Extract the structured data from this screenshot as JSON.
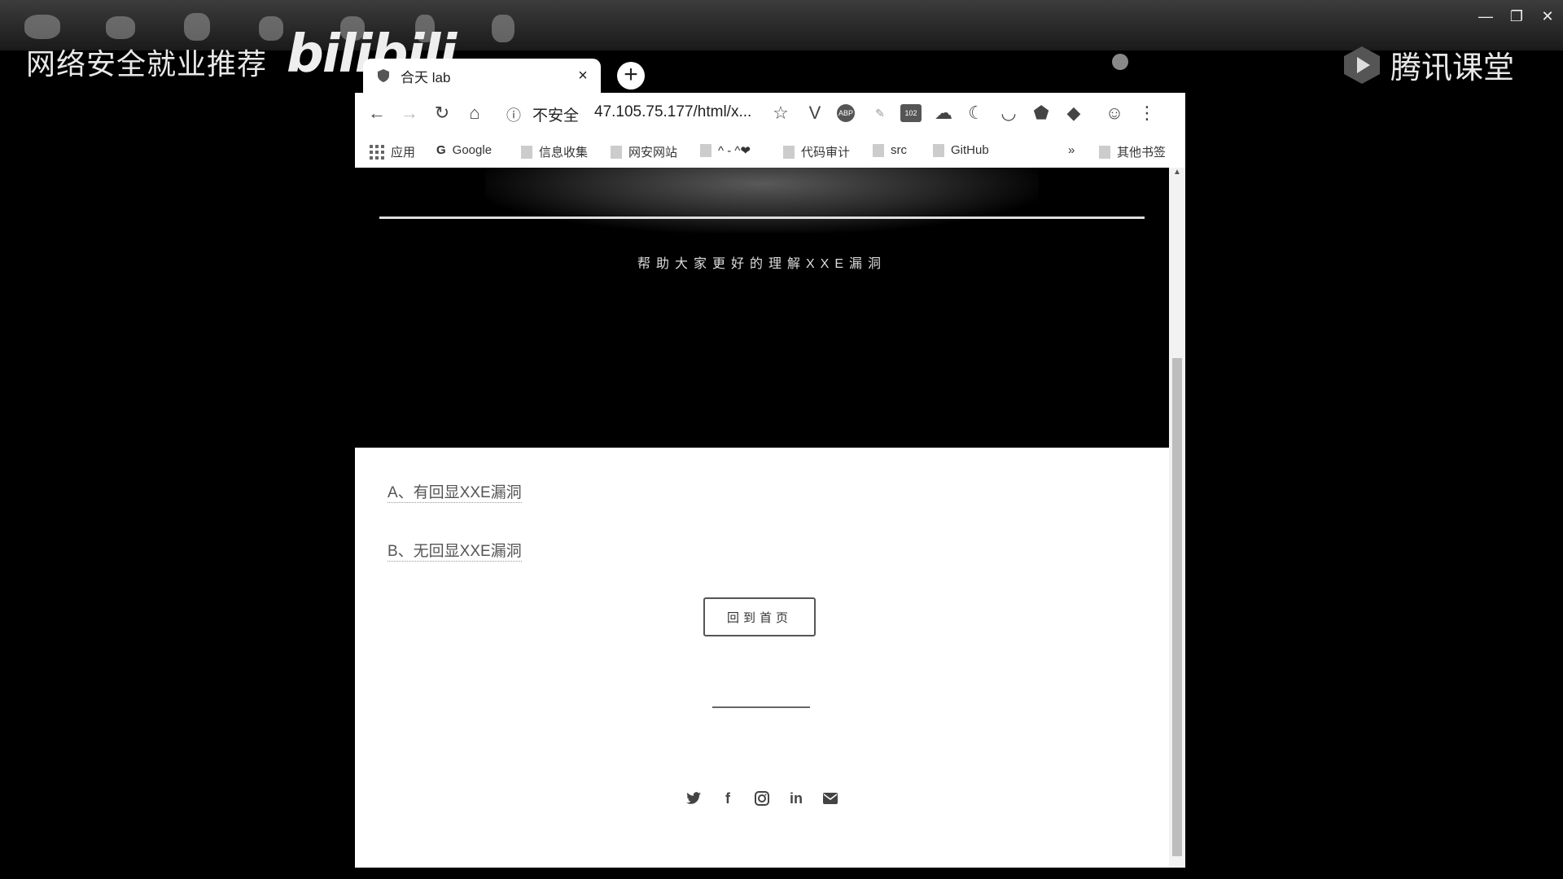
{
  "overlay": {
    "left_title": "网络安全就业推荐",
    "bili_logo": "bilibili",
    "tencent_logo": "腾讯课堂"
  },
  "browser": {
    "tab_title": "合天 lab",
    "tab_close": "×",
    "new_tab": "+",
    "address": {
      "security_label": "不安全",
      "url": "47.105.75.177/html/x..."
    },
    "extensions": [
      "ABP",
      "102"
    ],
    "bookmarks": [
      {
        "label": "应用",
        "icon": "apps-grid-icon"
      },
      {
        "label": "Google",
        "icon": "google-icon"
      },
      {
        "label": "信息收集",
        "icon": "folder-icon"
      },
      {
        "label": "网安网站",
        "icon": "folder-icon"
      },
      {
        "label": "^ - ^❤",
        "icon": "folder-icon"
      },
      {
        "label": "代码审计",
        "icon": "folder-icon"
      },
      {
        "label": "src",
        "icon": "folder-icon"
      },
      {
        "label": "GitHub",
        "icon": "folder-icon"
      }
    ],
    "bookmarks_overflow": "»",
    "other_bookmarks": "其他书签"
  },
  "page": {
    "hero_subtitle": "帮助大家更好的理解XXE漏洞",
    "links": [
      "A、有回显XXE漏洞",
      "B、无回显XXE漏洞"
    ],
    "home_button": "回到首页",
    "social_icons": [
      "twitter-icon",
      "facebook-icon",
      "instagram-icon",
      "linkedin-icon",
      "envelope-icon"
    ]
  }
}
